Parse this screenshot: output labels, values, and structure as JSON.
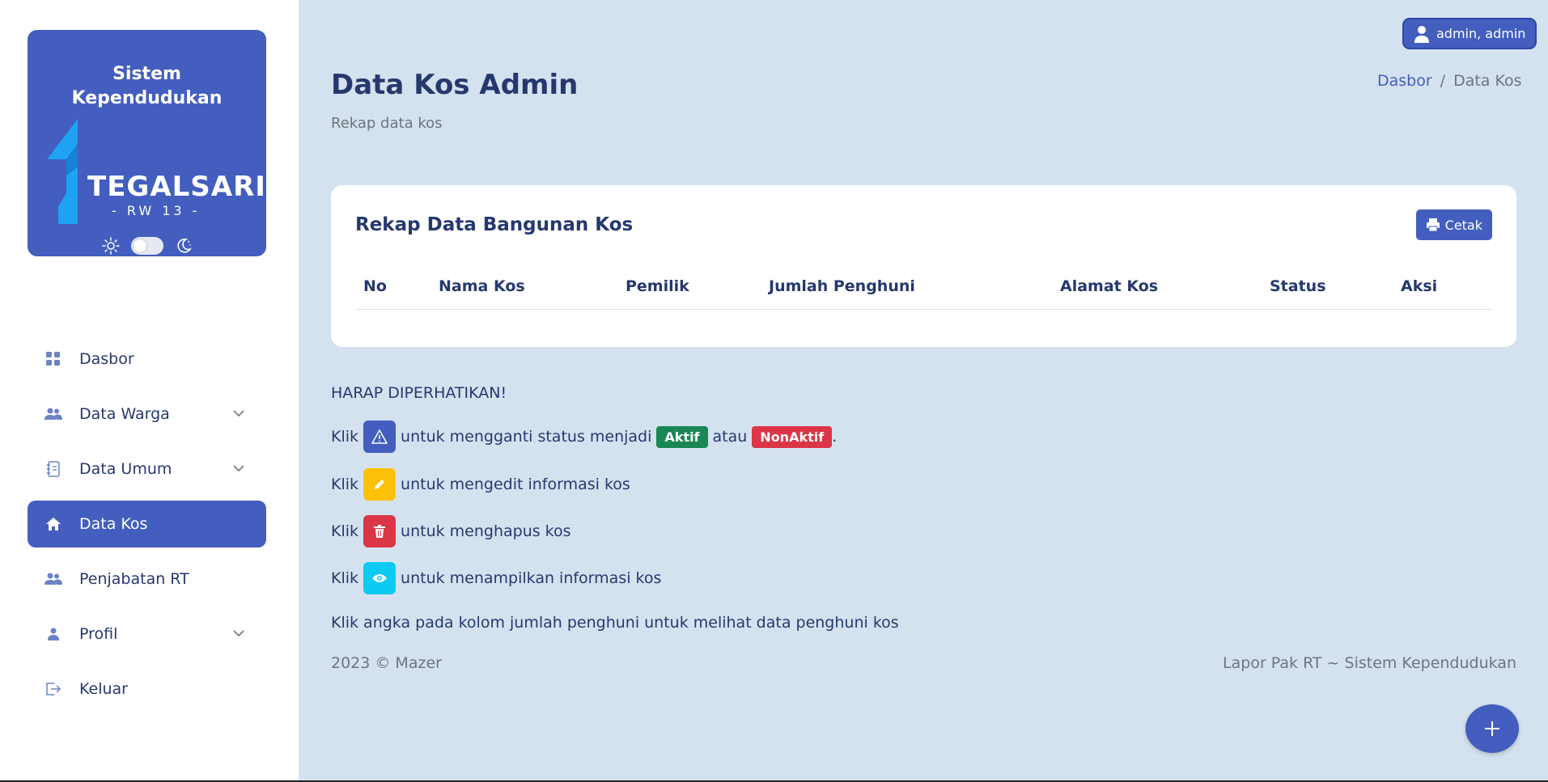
{
  "sidebar": {
    "brand_title": "Sistem Kependudukan",
    "logo_word": "TEGALSARI",
    "logo_sub": "- RW 13 -",
    "menu": [
      {
        "label": "Dasbor",
        "icon": "grid-icon",
        "has_chevron": false,
        "active": false
      },
      {
        "label": "Data Warga",
        "icon": "people-icon",
        "has_chevron": true,
        "active": false
      },
      {
        "label": "Data Umum",
        "icon": "journal-icon",
        "has_chevron": true,
        "active": false
      },
      {
        "label": "Data Kos",
        "icon": "house-icon",
        "has_chevron": false,
        "active": true
      },
      {
        "label": "Penjabatan RT",
        "icon": "people-icon",
        "has_chevron": false,
        "active": false
      },
      {
        "label": "Profil",
        "icon": "person-icon",
        "has_chevron": true,
        "active": false
      },
      {
        "label": "Keluar",
        "icon": "logout-icon",
        "has_chevron": false,
        "active": false
      }
    ]
  },
  "header": {
    "user_label": "admin, admin",
    "title": "Data Kos Admin",
    "subtitle": "Rekap data kos",
    "breadcrumb": {
      "link": "Dasbor",
      "sep": "/",
      "current": "Data Kos"
    }
  },
  "card": {
    "title": "Rekap Data Bangunan Kos",
    "print_label": "Cetak",
    "columns": [
      "No",
      "Nama Kos",
      "Pemilik",
      "Jumlah Penghuni",
      "Alamat Kos",
      "Status",
      "Aksi"
    ]
  },
  "notice": {
    "heading": "HARAP DIPERHATIKAN!",
    "klik": "Klik",
    "status_text": "untuk mengganti status menjadi",
    "badge_active": "Aktif",
    "atau": "atau",
    "badge_inactive": "NonAktif",
    "period": ".",
    "edit_text": "untuk mengedit informasi kos",
    "delete_text": "untuk menghapus kos",
    "view_text": "untuk menampilkan informasi kos",
    "info_line": "Klik angka pada kolom jumlah penghuni untuk melihat data penghuni kos"
  },
  "footer": {
    "left": "2023 © Mazer",
    "right": "Lapor Pak RT ~ Sistem Kependudukan"
  },
  "colors": {
    "primary": "#435ebe",
    "background": "#d4e2f0",
    "success": "#198754",
    "danger": "#dc3545",
    "warning": "#ffc107",
    "info": "#0dcaf0"
  }
}
